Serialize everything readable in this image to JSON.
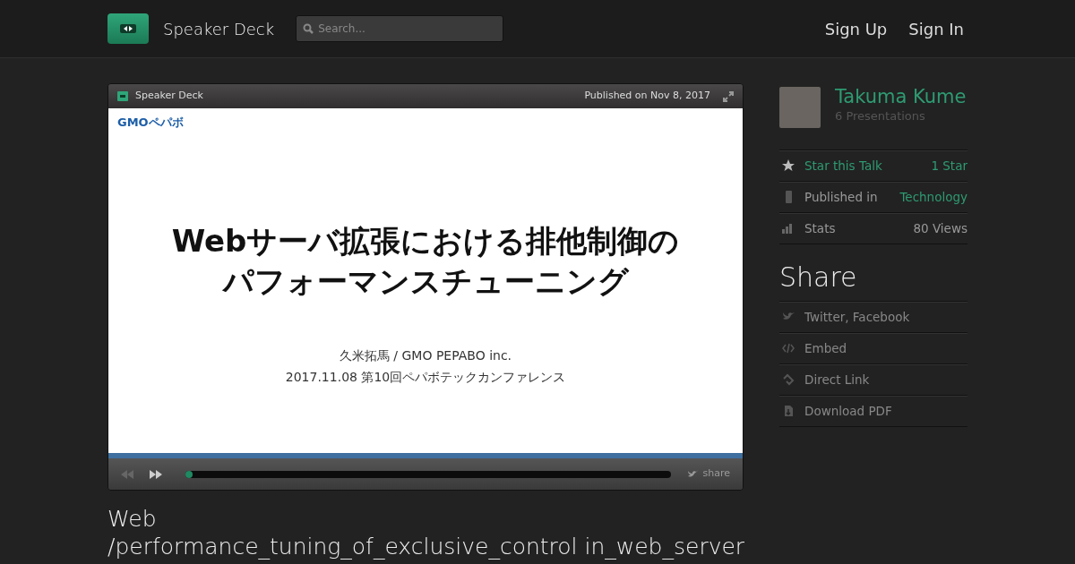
{
  "header": {
    "brand": "Speaker Deck",
    "search": {
      "placeholder": "Search..."
    },
    "nav": [
      "Sign Up",
      "Sign In"
    ]
  },
  "player": {
    "brand": "Speaker Deck",
    "published": "Published on Nov 8, 2017",
    "slide": {
      "logo": "GMOペパボ",
      "title_lines": [
        "Webサーバ拡張における排他制御の",
        "パフォーマンスチューニング"
      ],
      "author": "久米拓馬 / GMO PEPABO inc.",
      "event": "2017.11.08 第10回ペパボテックカンファレンス"
    },
    "progress": {
      "level": 0.0
    },
    "share": "share"
  },
  "talk_title": [
    "Web",
    "/performance_tuning_of_exclusive_control in_web_server"
  ],
  "author": {
    "name": "Takuma Kume",
    "presentations": "6 Presentations"
  },
  "details": [
    {
      "kind": "star",
      "label": "Star this Talk",
      "value": "1 Star"
    },
    {
      "kind": "category",
      "label": "Published in",
      "value": "Technology"
    },
    {
      "kind": "stats",
      "label": "Stats",
      "value": "80 Views"
    }
  ],
  "share": {
    "heading": "Share",
    "items": [
      {
        "kind": "social",
        "label": "Twitter, Facebook"
      },
      {
        "kind": "embed",
        "label": "Embed"
      },
      {
        "kind": "link",
        "label": "Direct Link"
      },
      {
        "kind": "pdf",
        "label": "Download PDF"
      }
    ]
  }
}
